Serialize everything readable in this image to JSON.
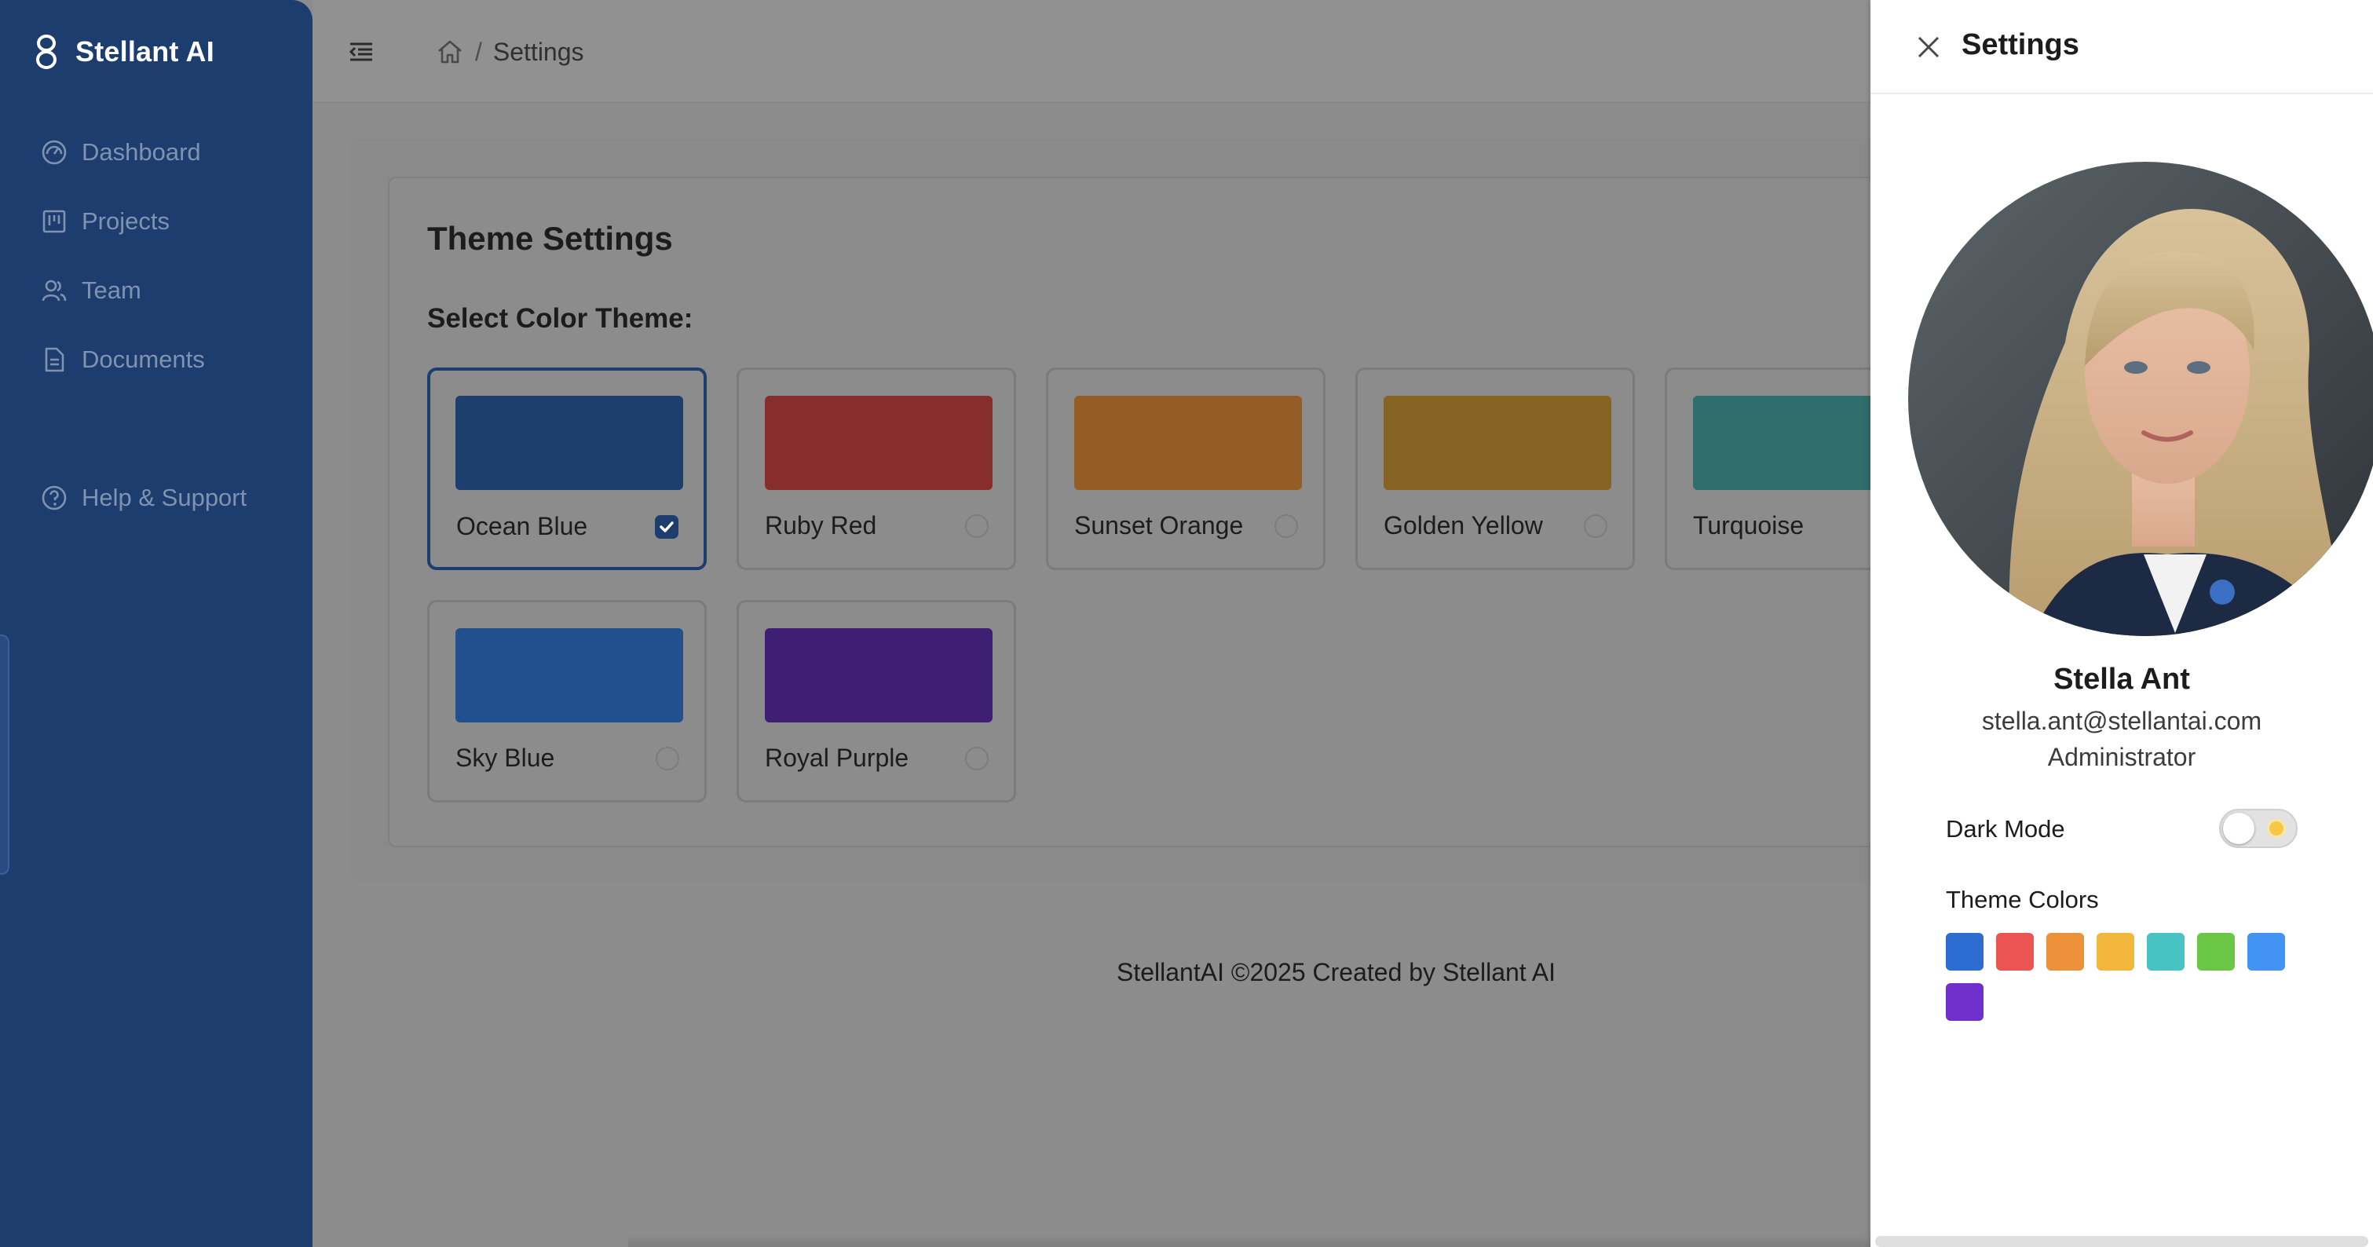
{
  "app": {
    "name": "Stellant AI"
  },
  "sidebar": {
    "items": [
      {
        "label": "Dashboard",
        "icon": "dashboard-icon"
      },
      {
        "label": "Projects",
        "icon": "projects-icon"
      },
      {
        "label": "Team",
        "icon": "team-icon"
      },
      {
        "label": "Documents",
        "icon": "documents-icon"
      }
    ],
    "help": {
      "label": "Help & Support",
      "icon": "help-icon"
    }
  },
  "header": {
    "breadcrumb": {
      "home_icon": "home-icon",
      "separator": "/",
      "current": "Settings"
    }
  },
  "main": {
    "title": "Theme Settings",
    "subtitle": "Select Color Theme:",
    "themes": [
      {
        "label": "Ocean Blue",
        "color": "#1c3f6e",
        "selected": true
      },
      {
        "label": "Ruby Red",
        "color": "#872d2b",
        "selected": false
      },
      {
        "label": "Sunset Orange",
        "color": "#935d25",
        "selected": false
      },
      {
        "label": "Golden Yellow",
        "color": "#866322",
        "selected": false
      },
      {
        "label": "Turquoise",
        "color": "#2f6e6a",
        "selected": false
      },
      {
        "label": "Sky Blue",
        "color": "#22508f",
        "selected": false
      },
      {
        "label": "Royal Purple",
        "color": "#3e1f74",
        "selected": false
      }
    ]
  },
  "footer": {
    "text": "StellantAI ©2025 Created by Stellant AI"
  },
  "drawer": {
    "title": "Settings",
    "user": {
      "name": "Stella Ant",
      "email": "stella.ant@stellantai.com",
      "role": "Administrator"
    },
    "dark_mode": {
      "label": "Dark Mode",
      "enabled": false
    },
    "theme_colors": {
      "label": "Theme Colors",
      "colors": [
        "#2d6cd1",
        "#ec5454",
        "#ec9139",
        "#f4b73e",
        "#48c2c2",
        "#6cc646",
        "#4393f4",
        "#7030cc"
      ]
    }
  }
}
